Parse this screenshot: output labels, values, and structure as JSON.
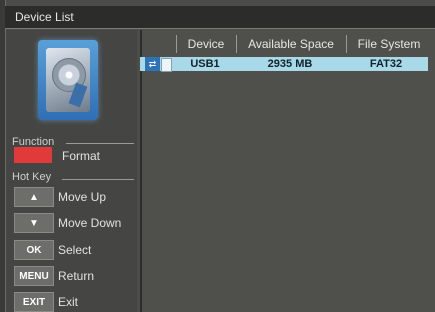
{
  "window": {
    "title": "Device List"
  },
  "sidebar": {
    "function_label": "Function",
    "function_action": "Format",
    "hotkey_label": "Hot Key",
    "hotkeys": [
      {
        "key": "▲",
        "action": "Move Up"
      },
      {
        "key": "▼",
        "action": "Move Down"
      },
      {
        "key": "OK",
        "action": "Select"
      },
      {
        "key": "MENU",
        "action": "Return"
      },
      {
        "key": "EXIT",
        "action": "Exit"
      }
    ]
  },
  "table": {
    "headers": [
      "Device",
      "Available Space",
      "File System"
    ],
    "rows": [
      {
        "device": "USB1",
        "space": "2935 MB",
        "fs": "FAT32"
      }
    ]
  },
  "colors": {
    "function_key": "#e03a3a",
    "selected_row": "#a9d9e8",
    "usb_icon": "#2b74b8"
  },
  "icons": {
    "drive": "hard-disk-icon",
    "usb": "usb-icon"
  }
}
